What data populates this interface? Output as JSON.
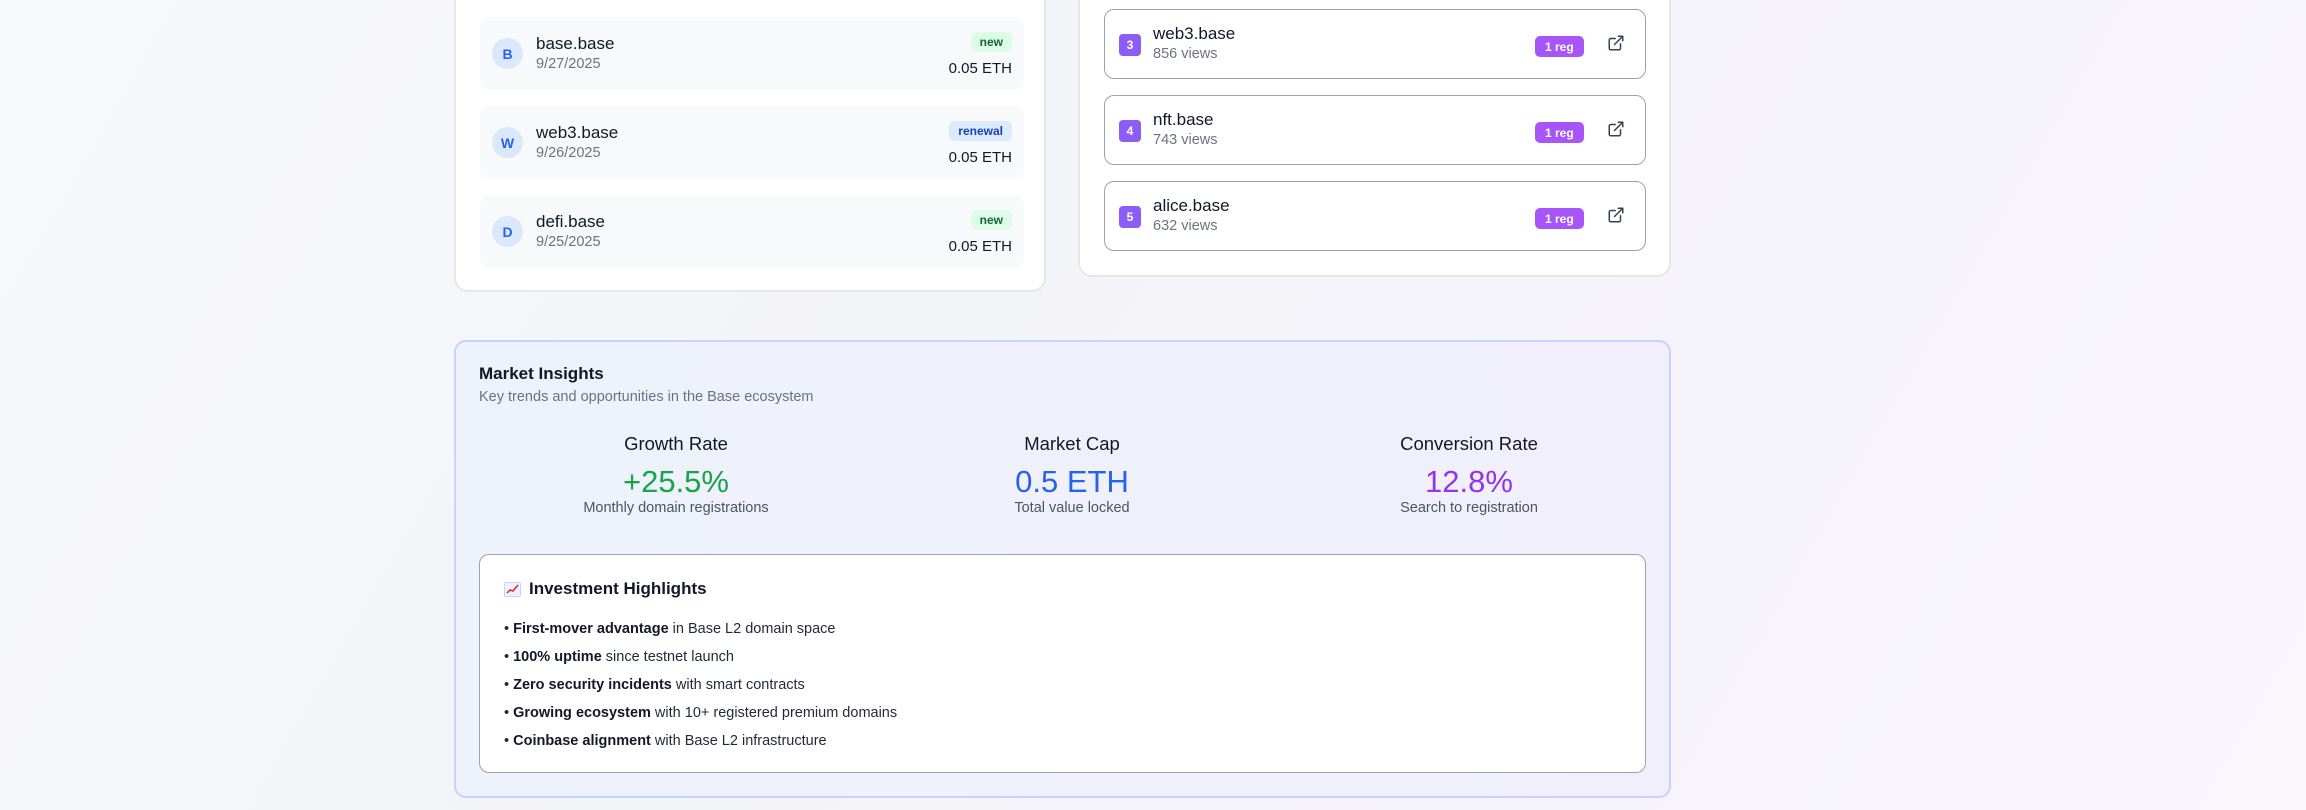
{
  "recent_registrations": [
    {
      "initial": "B",
      "name": "base.base",
      "date": "9/27/2025",
      "badge": "new",
      "price": "0.05 ETH"
    },
    {
      "initial": "W",
      "name": "web3.base",
      "date": "9/26/2025",
      "badge": "renewal",
      "price": "0.05 ETH"
    },
    {
      "initial": "D",
      "name": "defi.base",
      "date": "9/25/2025",
      "badge": "new",
      "price": "0.05 ETH"
    }
  ],
  "top_domains": [
    {
      "rank": "3",
      "name": "web3.base",
      "views": "856 views",
      "reg": "1 reg",
      "link_icon": "external-link-icon"
    },
    {
      "rank": "4",
      "name": "nft.base",
      "views": "743 views",
      "reg": "1 reg",
      "link_icon": "external-link-icon"
    },
    {
      "rank": "5",
      "name": "alice.base",
      "views": "632 views",
      "reg": "1 reg",
      "link_icon": "external-link-icon"
    }
  ],
  "insights": {
    "title": "Market Insights",
    "subtitle": "Key trends and opportunities in the Base ecosystem",
    "metrics": [
      {
        "label": "Growth Rate",
        "value": "+25.5%",
        "desc": "Monthly domain registrations",
        "color": "#16a34a"
      },
      {
        "label": "Market Cap",
        "value": "0.5 ETH",
        "desc": "Total value locked",
        "color": "#2563eb"
      },
      {
        "label": "Conversion Rate",
        "value": "12.8%",
        "desc": "Search to registration",
        "color": "#9333ea"
      }
    ],
    "highlights": {
      "icon": "chart-increasing-icon",
      "title": "Investment Highlights",
      "items": [
        {
          "bold": "First-mover advantage",
          "rest": " in Base L2 domain space"
        },
        {
          "bold": "100% uptime",
          "rest": " since testnet launch"
        },
        {
          "bold": "Zero security incidents",
          "rest": " with smart contracts"
        },
        {
          "bold": "Growing ecosystem",
          "rest": " with 10+ registered premium domains"
        },
        {
          "bold": "Coinbase alignment",
          "rest": " with Base L2 infrastructure"
        }
      ]
    }
  },
  "colors": {
    "badge_new_bg": "#dcfce7",
    "badge_renewal_bg": "#dbeafe",
    "rank_badge": "#8b5cf6",
    "reg_pill": "#a855f7"
  }
}
